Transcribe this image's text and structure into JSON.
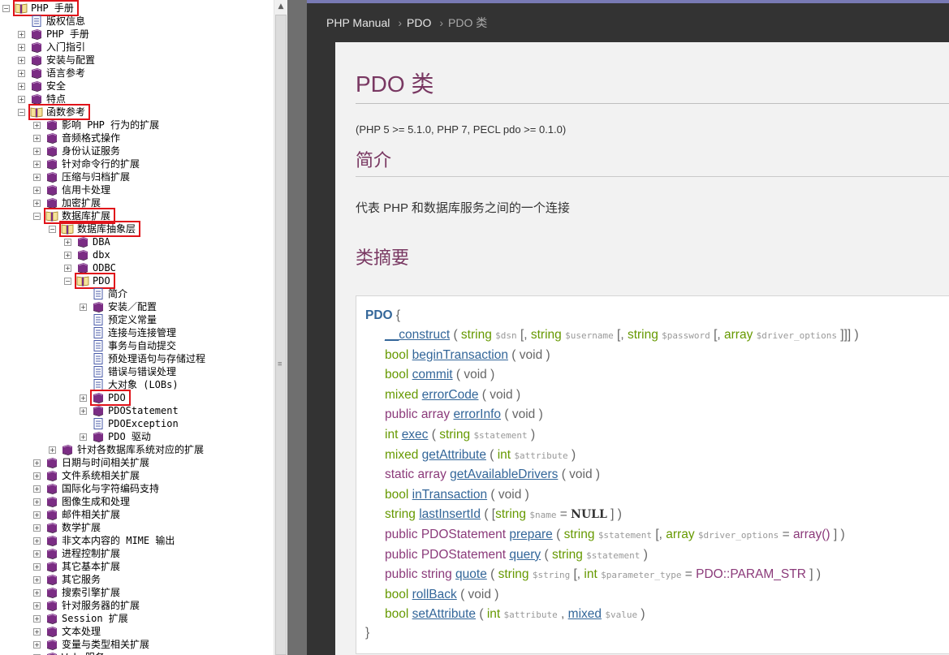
{
  "tree": {
    "nodes": [
      {
        "label": "PHP 手册",
        "icon": "book-open-icon",
        "expander": "minus",
        "level": 0
      },
      {
        "label": "版权信息",
        "icon": "page-icon",
        "expander": "",
        "level": 1
      },
      {
        "label": "PHP 手册",
        "icon": "book-closed-icon",
        "expander": "plus",
        "level": 1
      },
      {
        "label": "入门指引",
        "icon": "book-closed-icon",
        "expander": "plus",
        "level": 1
      },
      {
        "label": "安装与配置",
        "icon": "book-closed-icon",
        "expander": "plus",
        "level": 1
      },
      {
        "label": "语言参考",
        "icon": "book-closed-icon",
        "expander": "plus",
        "level": 1
      },
      {
        "label": "安全",
        "icon": "book-closed-icon",
        "expander": "plus",
        "level": 1
      },
      {
        "label": "特点",
        "icon": "book-closed-icon",
        "expander": "plus",
        "level": 1
      },
      {
        "label": "函数参考",
        "icon": "book-open-icon",
        "expander": "minus",
        "level": 1
      },
      {
        "label": "影响 PHP 行为的扩展",
        "icon": "book-closed-icon",
        "expander": "plus",
        "level": 2
      },
      {
        "label": "音频格式操作",
        "icon": "book-closed-icon",
        "expander": "plus",
        "level": 2
      },
      {
        "label": "身份认证服务",
        "icon": "book-closed-icon",
        "expander": "plus",
        "level": 2
      },
      {
        "label": "针对命令行的扩展",
        "icon": "book-closed-icon",
        "expander": "plus",
        "level": 2
      },
      {
        "label": "压缩与归档扩展",
        "icon": "book-closed-icon",
        "expander": "plus",
        "level": 2
      },
      {
        "label": "信用卡处理",
        "icon": "book-closed-icon",
        "expander": "plus",
        "level": 2
      },
      {
        "label": "加密扩展",
        "icon": "book-closed-icon",
        "expander": "plus",
        "level": 2
      },
      {
        "label": "数据库扩展",
        "icon": "book-open-icon",
        "expander": "minus",
        "level": 2
      },
      {
        "label": "数据库抽象层",
        "icon": "book-open-icon",
        "expander": "minus",
        "level": 3
      },
      {
        "label": "DBA",
        "icon": "book-closed-icon",
        "expander": "plus",
        "level": 4
      },
      {
        "label": "dbx",
        "icon": "book-closed-icon",
        "expander": "plus",
        "level": 4
      },
      {
        "label": "ODBC",
        "icon": "book-closed-icon",
        "expander": "plus",
        "level": 4
      },
      {
        "label": "PDO",
        "icon": "book-open-icon",
        "expander": "minus",
        "level": 4
      },
      {
        "label": "简介",
        "icon": "page-icon",
        "expander": "",
        "level": 5
      },
      {
        "label": "安装／配置",
        "icon": "book-closed-icon",
        "expander": "plus",
        "level": 5
      },
      {
        "label": "预定义常量",
        "icon": "page-icon",
        "expander": "",
        "level": 5
      },
      {
        "label": "连接与连接管理",
        "icon": "page-icon",
        "expander": "",
        "level": 5
      },
      {
        "label": "事务与自动提交",
        "icon": "page-icon",
        "expander": "",
        "level": 5
      },
      {
        "label": "预处理语句与存储过程",
        "icon": "page-icon",
        "expander": "",
        "level": 5
      },
      {
        "label": "错误与错误处理",
        "icon": "page-icon",
        "expander": "",
        "level": 5
      },
      {
        "label": "大对象 (LOBs)",
        "icon": "page-icon",
        "expander": "",
        "level": 5
      },
      {
        "label": "PDO",
        "icon": "book-closed-icon",
        "expander": "plus",
        "level": 5
      },
      {
        "label": "PDOStatement",
        "icon": "book-closed-icon",
        "expander": "plus",
        "level": 5
      },
      {
        "label": "PDOException",
        "icon": "page-icon",
        "expander": "",
        "level": 5
      },
      {
        "label": "PDO 驱动",
        "icon": "book-closed-icon",
        "expander": "plus",
        "level": 5
      },
      {
        "label": "针对各数据库系统对应的扩展",
        "icon": "book-closed-icon",
        "expander": "plus",
        "level": 3
      },
      {
        "label": "日期与时间相关扩展",
        "icon": "book-closed-icon",
        "expander": "plus",
        "level": 2
      },
      {
        "label": "文件系统相关扩展",
        "icon": "book-closed-icon",
        "expander": "plus",
        "level": 2
      },
      {
        "label": "国际化与字符编码支持",
        "icon": "book-closed-icon",
        "expander": "plus",
        "level": 2
      },
      {
        "label": "图像生成和处理",
        "icon": "book-closed-icon",
        "expander": "plus",
        "level": 2
      },
      {
        "label": "邮件相关扩展",
        "icon": "book-closed-icon",
        "expander": "plus",
        "level": 2
      },
      {
        "label": "数学扩展",
        "icon": "book-closed-icon",
        "expander": "plus",
        "level": 2
      },
      {
        "label": "非文本内容的 MIME 输出",
        "icon": "book-closed-icon",
        "expander": "plus",
        "level": 2
      },
      {
        "label": "进程控制扩展",
        "icon": "book-closed-icon",
        "expander": "plus",
        "level": 2
      },
      {
        "label": "其它基本扩展",
        "icon": "book-closed-icon",
        "expander": "plus",
        "level": 2
      },
      {
        "label": "其它服务",
        "icon": "book-closed-icon",
        "expander": "plus",
        "level": 2
      },
      {
        "label": "搜索引擎扩展",
        "icon": "book-closed-icon",
        "expander": "plus",
        "level": 2
      },
      {
        "label": "针对服务器的扩展",
        "icon": "book-closed-icon",
        "expander": "plus",
        "level": 2
      },
      {
        "label": "Session 扩展",
        "icon": "book-closed-icon",
        "expander": "plus",
        "level": 2
      },
      {
        "label": "文本处理",
        "icon": "book-closed-icon",
        "expander": "plus",
        "level": 2
      },
      {
        "label": "变量与类型相关扩展",
        "icon": "book-closed-icon",
        "expander": "plus",
        "level": 2
      },
      {
        "label": "Web 服务",
        "icon": "book-closed-icon",
        "expander": "plus",
        "level": 2
      }
    ],
    "highlighted": [
      0,
      8,
      16,
      17,
      21,
      30
    ],
    "highlight_color": "#e0131a"
  },
  "breadcrumb": {
    "items": [
      "PHP Manual",
      "PDO",
      "PDO 类"
    ],
    "separator": "›"
  },
  "page": {
    "title": "PDO 类",
    "version": "(PHP 5 >= 5.1.0, PHP 7, PECL pdo >= 0.1.0)",
    "intro_heading": "简介",
    "intro_text": "代表 PHP 和数据库服务之间的一个连接",
    "synopsis_heading": "类摘要"
  },
  "synopsis": {
    "class_name": "PDO",
    "open": "{",
    "close": "}",
    "methods": [
      {
        "mod": "",
        "ret": "",
        "name": "__construct",
        "params": [
          [
            "string",
            "$dsn"
          ],
          [
            "string",
            "$username",
            true
          ],
          [
            "string",
            "$password",
            true
          ],
          [
            "array",
            "$driver_options",
            true
          ]
        ],
        "tail": " ]]] )"
      },
      {
        "mod": "",
        "ret": "bool",
        "name": "beginTransaction",
        "void": true
      },
      {
        "mod": "",
        "ret": "bool",
        "name": "commit",
        "void": true
      },
      {
        "mod": "",
        "ret": "mixed",
        "name": "errorCode",
        "void": true
      },
      {
        "mod": "public",
        "ret": "array",
        "name": "errorInfo",
        "void": true
      },
      {
        "mod": "",
        "ret": "int",
        "name": "exec",
        "params": [
          [
            "string",
            "$statement"
          ]
        ]
      },
      {
        "mod": "",
        "ret": "mixed",
        "name": "getAttribute",
        "params": [
          [
            "int",
            "$attribute"
          ]
        ]
      },
      {
        "mod": "static",
        "ret": "array",
        "name": "getAvailableDrivers",
        "void": true
      },
      {
        "mod": "",
        "ret": "bool",
        "name": "inTransaction",
        "void": true
      },
      {
        "mod": "",
        "ret": "string",
        "name": "lastInsertId",
        "params": [
          [
            "string",
            "$name",
            true,
            "NULL"
          ]
        ],
        "tail": " ] )"
      },
      {
        "mod": "public",
        "ret": "PDOStatement",
        "name": "prepare",
        "params": [
          [
            "string",
            "$statement"
          ],
          [
            "array",
            "$driver_options",
            true,
            "array()"
          ]
        ],
        "tail": " ] )"
      },
      {
        "mod": "public",
        "ret": "PDOStatement",
        "name": "query",
        "params": [
          [
            "string",
            "$statement"
          ]
        ]
      },
      {
        "mod": "public",
        "ret": "string",
        "name": "quote",
        "params": [
          [
            "string",
            "$string"
          ],
          [
            "int",
            "$parameter_type",
            true,
            "PDO::PARAM_STR"
          ]
        ],
        "tail": " ] )"
      },
      {
        "mod": "",
        "ret": "bool",
        "name": "rollBack",
        "void": true
      },
      {
        "mod": "",
        "ret": "bool",
        "name": "setAttribute",
        "params": [
          [
            "int",
            "$attribute"
          ],
          [
            "mixed",
            "$value"
          ]
        ]
      }
    ]
  },
  "colors": {
    "title": "#793862",
    "type": "#669900",
    "method": "#336699",
    "modifier": "#8b3a7a"
  }
}
